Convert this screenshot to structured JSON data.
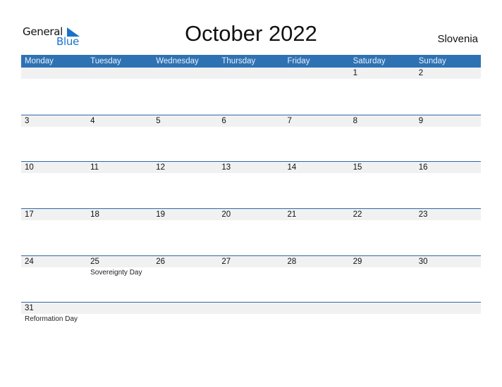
{
  "logo": {
    "word1": "General",
    "word2": "Blue",
    "icon": "triangle-flag-icon"
  },
  "title": "October 2022",
  "country": "Slovenia",
  "colors": {
    "header_bg": "#2e72b4",
    "accent": "#1a73c8",
    "row_band": "#f1f1f1"
  },
  "weekdays": [
    "Monday",
    "Tuesday",
    "Wednesday",
    "Thursday",
    "Friday",
    "Saturday",
    "Sunday"
  ],
  "weeks": [
    [
      {
        "d": ""
      },
      {
        "d": ""
      },
      {
        "d": ""
      },
      {
        "d": ""
      },
      {
        "d": ""
      },
      {
        "d": "1"
      },
      {
        "d": "2"
      }
    ],
    [
      {
        "d": "3"
      },
      {
        "d": "4"
      },
      {
        "d": "5"
      },
      {
        "d": "6"
      },
      {
        "d": "7"
      },
      {
        "d": "8"
      },
      {
        "d": "9"
      }
    ],
    [
      {
        "d": "10"
      },
      {
        "d": "11"
      },
      {
        "d": "12"
      },
      {
        "d": "13"
      },
      {
        "d": "14"
      },
      {
        "d": "15"
      },
      {
        "d": "16"
      }
    ],
    [
      {
        "d": "17"
      },
      {
        "d": "18"
      },
      {
        "d": "19"
      },
      {
        "d": "20"
      },
      {
        "d": "21"
      },
      {
        "d": "22"
      },
      {
        "d": "23"
      }
    ],
    [
      {
        "d": "24"
      },
      {
        "d": "25",
        "event": "Sovereignty Day"
      },
      {
        "d": "26"
      },
      {
        "d": "27"
      },
      {
        "d": "28"
      },
      {
        "d": "29"
      },
      {
        "d": "30"
      }
    ],
    [
      {
        "d": "31",
        "event": "Reformation Day"
      },
      {
        "d": ""
      },
      {
        "d": ""
      },
      {
        "d": ""
      },
      {
        "d": ""
      },
      {
        "d": ""
      },
      {
        "d": ""
      }
    ]
  ]
}
